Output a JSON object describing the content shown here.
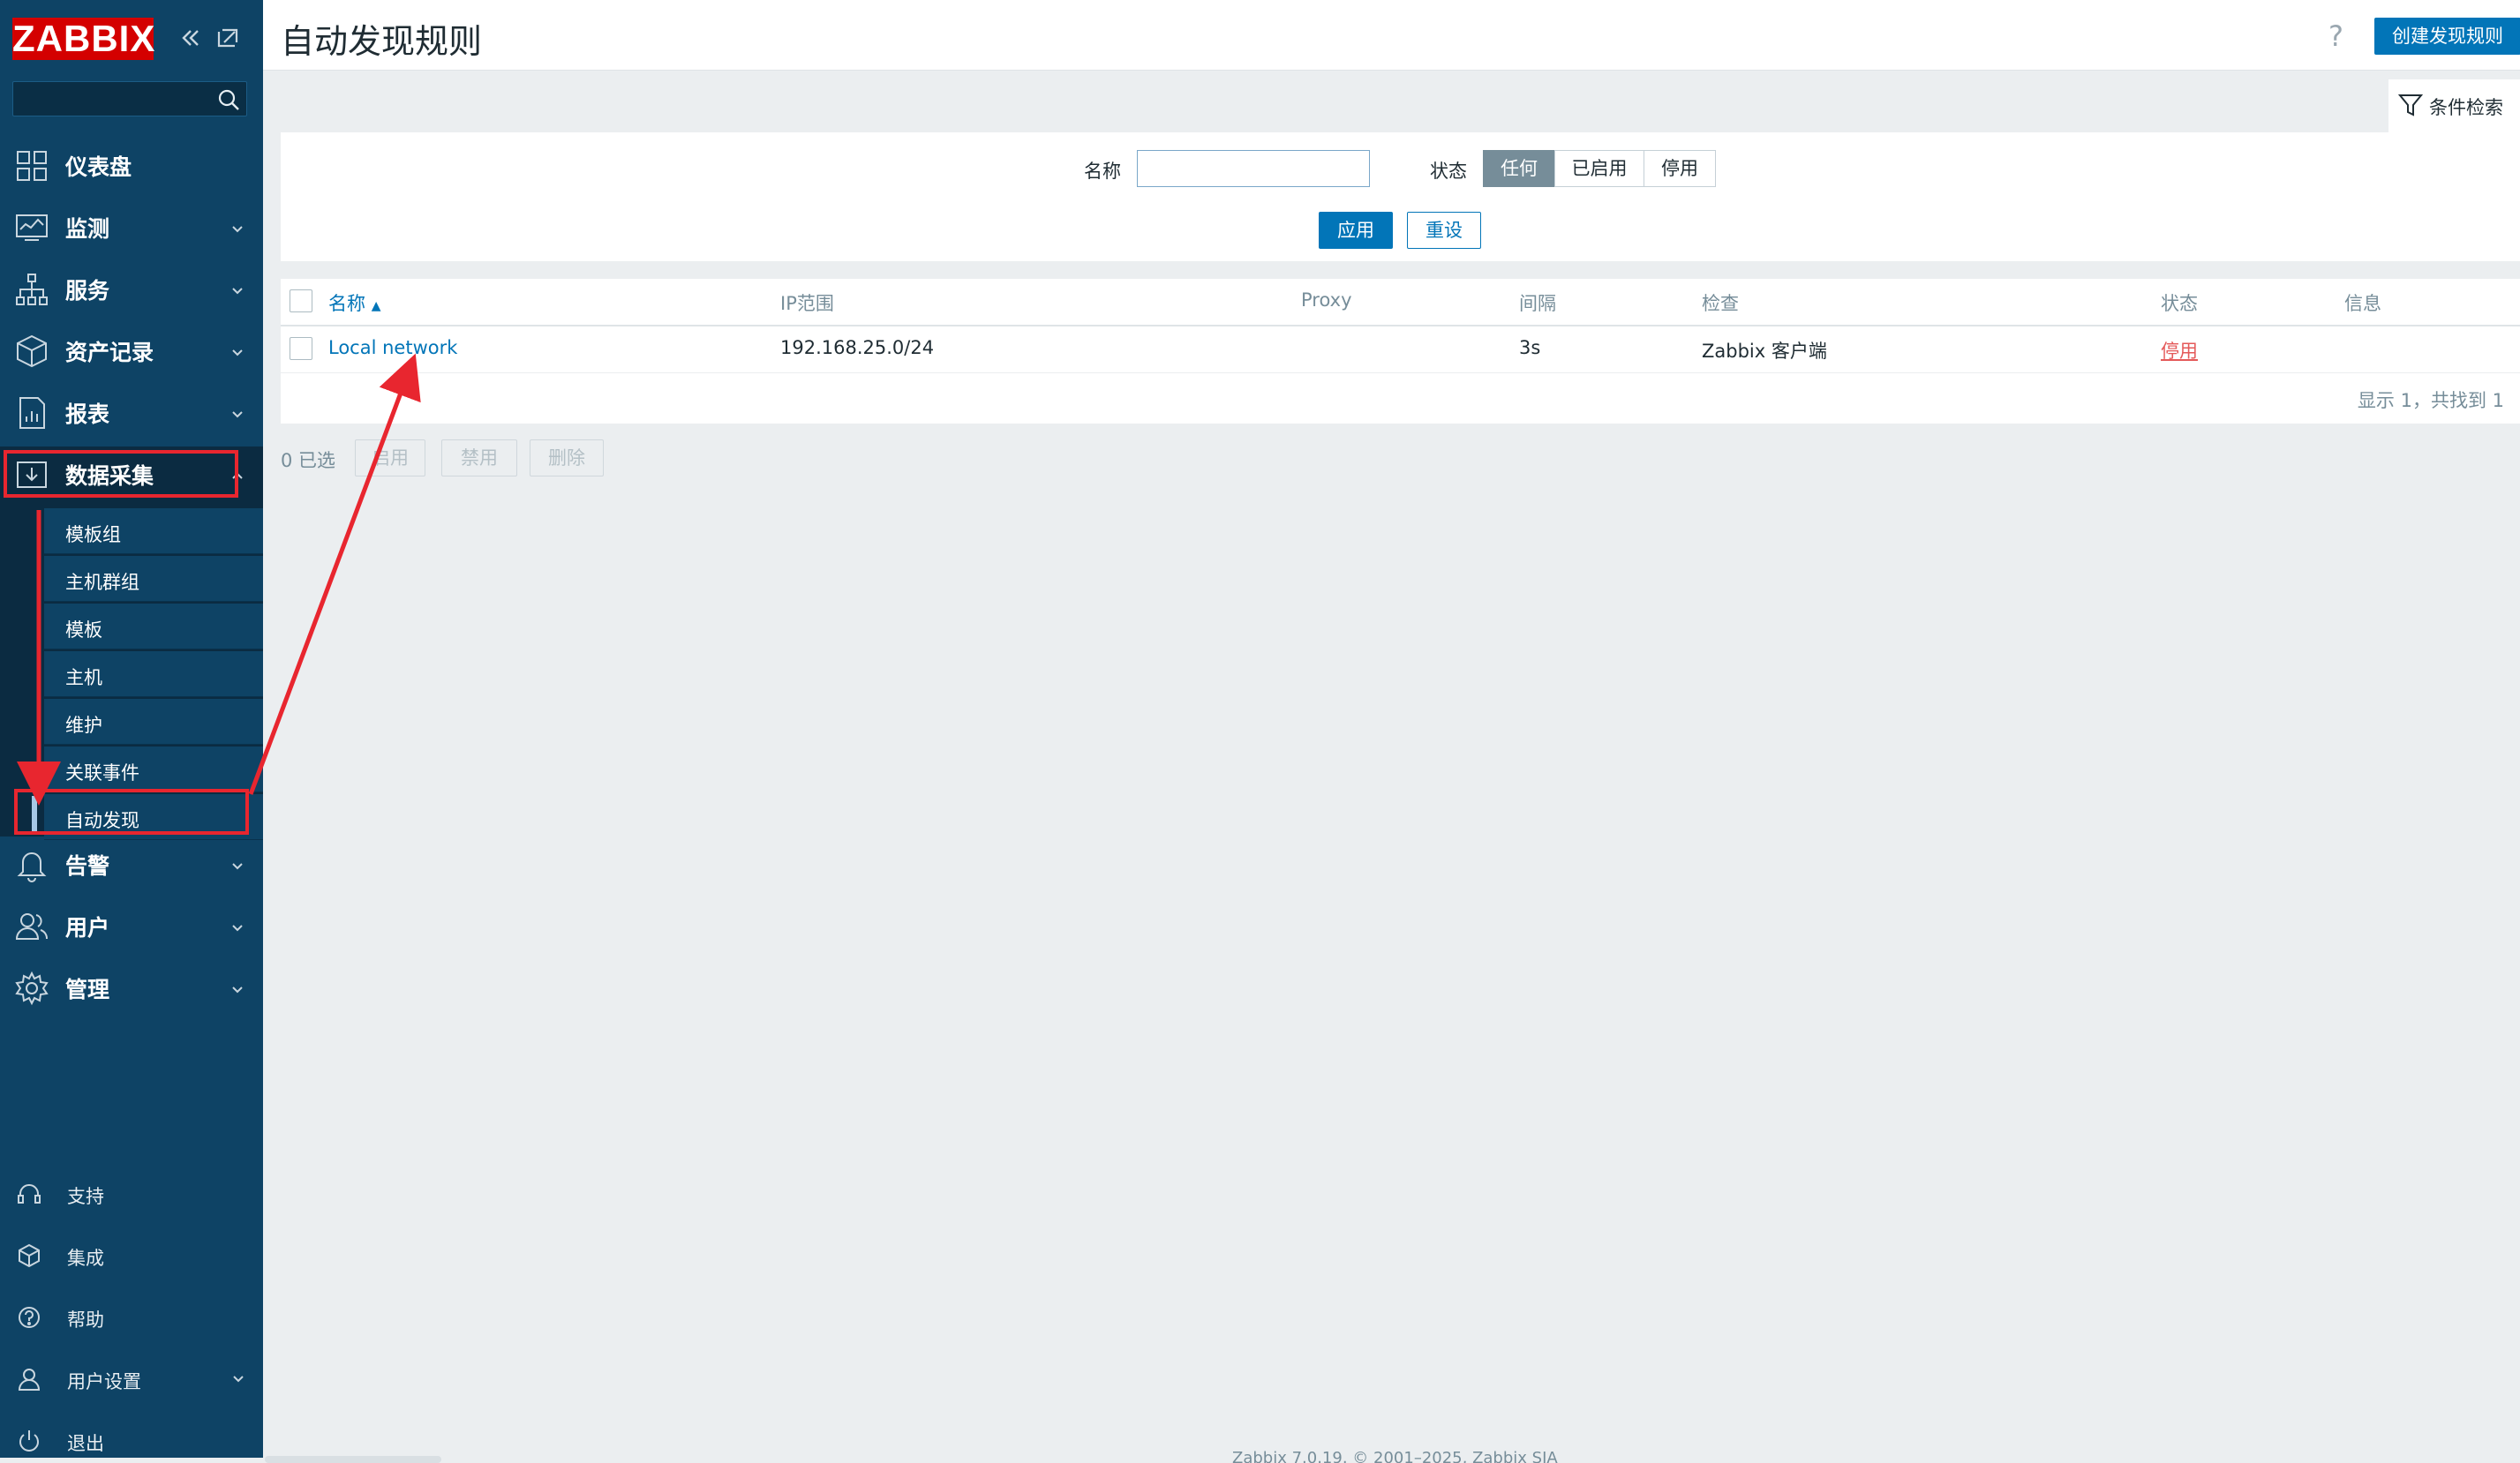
{
  "brand": {
    "logo_text": "ZABBIX",
    "logo_color": "#d40000",
    "sidebar_color": "#0e4365"
  },
  "sidebar": {
    "collapse_icon": "double-chevron-left-icon",
    "kiosk_icon": "expand-icon",
    "search": {
      "placeholder": "",
      "icon": "search-icon"
    },
    "menu": [
      {
        "label": "仪表盘",
        "icon": "dashboard-icon"
      },
      {
        "label": "监测",
        "icon": "monitoring-icon"
      },
      {
        "label": "服务",
        "icon": "services-icon"
      },
      {
        "label": "资产记录",
        "icon": "inventory-icon"
      },
      {
        "label": "报表",
        "icon": "reports-icon"
      },
      {
        "label": "数据采集",
        "icon": "data-collection-icon"
      },
      {
        "label": "告警",
        "icon": "bell-icon"
      },
      {
        "label": "用户",
        "icon": "users-icon"
      },
      {
        "label": "管理",
        "icon": "gear-icon"
      }
    ],
    "submenu": [
      {
        "label": "模板组"
      },
      {
        "label": "主机群组"
      },
      {
        "label": "模板"
      },
      {
        "label": "主机"
      },
      {
        "label": "维护"
      },
      {
        "label": "关联事件"
      },
      {
        "label": "自动发现"
      }
    ],
    "bottom": [
      {
        "label": "支持",
        "icon": "headset-icon"
      },
      {
        "label": "集成",
        "icon": "integrations-icon"
      },
      {
        "label": "帮助",
        "icon": "help-circle-icon"
      },
      {
        "label": "用户设置",
        "icon": "user-icon"
      },
      {
        "label": "退出",
        "icon": "power-icon"
      }
    ]
  },
  "header": {
    "title": "自动发现规则",
    "help": "?",
    "create_button": "创建发现规则"
  },
  "filter": {
    "tab_label": "条件检索",
    "name_label": "名称",
    "name_value": "",
    "status_label": "状态",
    "status_options": [
      "任何",
      "已启用",
      "停用"
    ],
    "status_selected": "任何",
    "apply": "应用",
    "reset": "重设"
  },
  "table": {
    "columns": [
      "名称",
      "IP范围",
      "Proxy",
      "间隔",
      "检查",
      "状态",
      "信息"
    ],
    "sort_indicator": "▲",
    "rows": [
      {
        "name": "Local network",
        "ip_range": "192.168.25.0/24",
        "proxy": "",
        "interval": "3s",
        "checks": "Zabbix 客户端",
        "status": "停用",
        "info": ""
      }
    ],
    "summary": "显示 1，共找到 1"
  },
  "mass_actions": {
    "selected": "0 已选",
    "buttons": [
      "启用",
      "禁用",
      "删除"
    ]
  },
  "footer": {
    "text": "Zabbix 7.0.19. © 2001–2025, Zabbix SIA"
  },
  "colors": {
    "accent": "#0275b8",
    "status_disabled": "#e45959",
    "annotation": "#e8262f"
  }
}
